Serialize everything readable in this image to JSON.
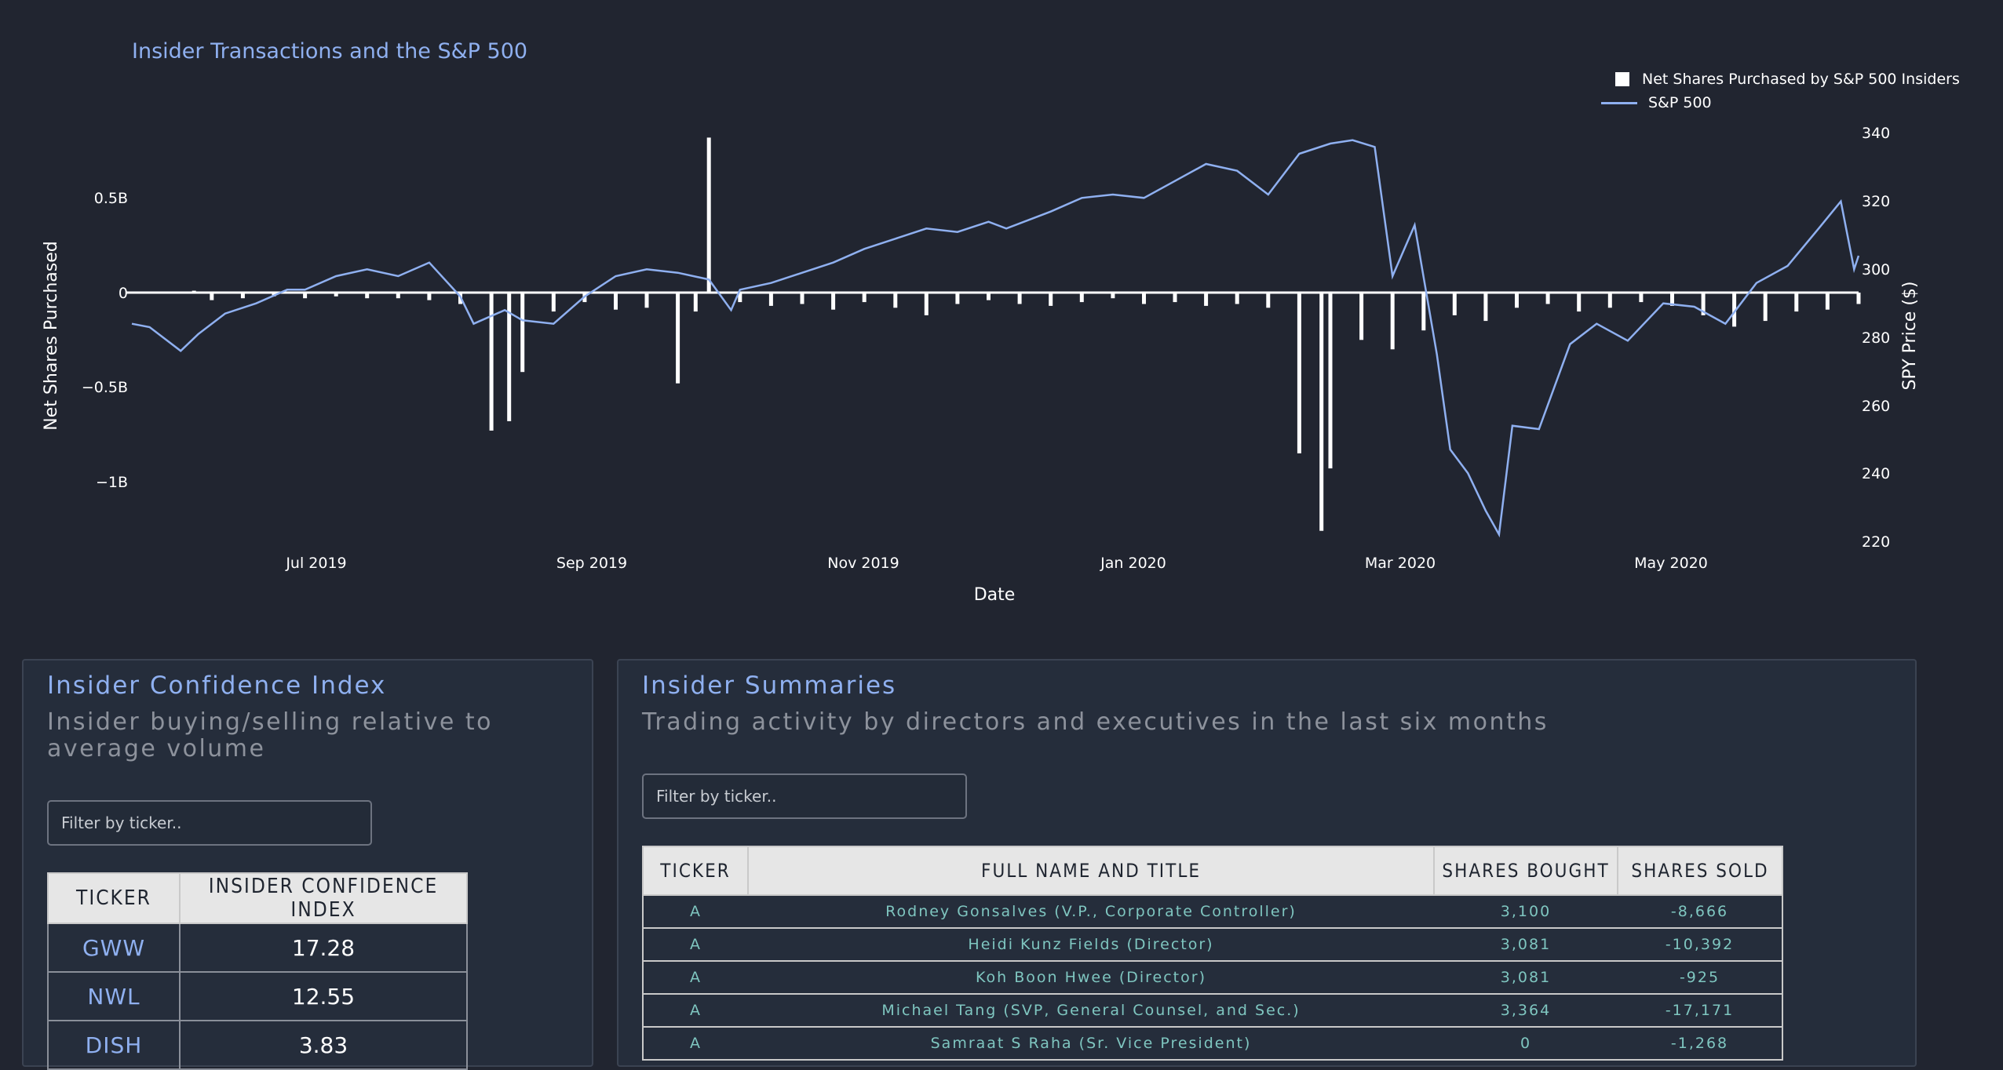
{
  "chart": {
    "title": "Insider Transactions and the S&P 500",
    "legend": [
      "Net Shares Purchased by S&P 500 Insiders",
      "S&P 500"
    ],
    "xlabel": "Date",
    "ylabel_left": "Net Shares Purchased",
    "ylabel_right": "SPY Price ($)",
    "x_ticks": [
      "Jul 2019",
      "Sep 2019",
      "Nov 2019",
      "Jan 2020",
      "Mar 2020",
      "May 2020"
    ],
    "y_left_ticks": [
      "0.5B",
      "0",
      "−0.5B",
      "−1B"
    ],
    "y_right_ticks": [
      "340",
      "320",
      "300",
      "280",
      "260",
      "240",
      "220"
    ]
  },
  "chart_data": {
    "type": "line",
    "title": "Insider Transactions and the S&P 500",
    "xlabel": "Date",
    "ylabel": "Net Shares Purchased",
    "y2label": "SPY Price ($)",
    "ylim": [
      -1.2,
      0.6
    ],
    "y2lim": [
      220,
      340
    ],
    "xlim": [
      "2019-05-20",
      "2020-06-12"
    ],
    "legend_position": "top-right",
    "series": [
      {
        "name": "S&P 500",
        "type": "line",
        "axis": "right",
        "color": "#8fb0f0",
        "x": [
          "2019-05-20",
          "2019-05-24",
          "2019-05-31",
          "2019-06-04",
          "2019-06-10",
          "2019-06-17",
          "2019-06-24",
          "2019-06-28",
          "2019-07-05",
          "2019-07-12",
          "2019-07-19",
          "2019-07-26",
          "2019-08-02",
          "2019-08-05",
          "2019-08-12",
          "2019-08-16",
          "2019-08-23",
          "2019-08-30",
          "2019-09-06",
          "2019-09-13",
          "2019-09-20",
          "2019-09-27",
          "2019-10-02",
          "2019-10-04",
          "2019-10-11",
          "2019-10-18",
          "2019-10-25",
          "2019-11-01",
          "2019-11-08",
          "2019-11-15",
          "2019-11-22",
          "2019-11-29",
          "2019-12-03",
          "2019-12-13",
          "2019-12-20",
          "2019-12-27",
          "2020-01-03",
          "2020-01-10",
          "2020-01-17",
          "2020-01-24",
          "2020-01-31",
          "2020-02-07",
          "2020-02-14",
          "2020-02-19",
          "2020-02-24",
          "2020-02-28",
          "2020-03-04",
          "2020-03-09",
          "2020-03-12",
          "2020-03-16",
          "2020-03-20",
          "2020-03-23",
          "2020-03-26",
          "2020-04-01",
          "2020-04-08",
          "2020-04-14",
          "2020-04-21",
          "2020-04-29",
          "2020-05-06",
          "2020-05-13",
          "2020-05-20",
          "2020-05-27",
          "2020-06-03",
          "2020-06-08",
          "2020-06-11",
          "2020-06-12"
        ],
        "values": [
          284,
          283,
          276,
          281,
          287,
          290,
          294,
          294,
          298,
          300,
          298,
          302,
          292,
          284,
          288,
          285,
          284,
          292,
          298,
          300,
          299,
          297,
          288,
          294,
          296,
          299,
          302,
          306,
          309,
          312,
          311,
          314,
          312,
          317,
          321,
          322,
          321,
          326,
          331,
          329,
          322,
          334,
          337,
          338,
          336,
          298,
          313,
          275,
          247,
          240,
          229,
          222,
          254,
          253,
          278,
          284,
          279,
          290,
          289,
          284,
          296,
          301,
          312,
          320,
          300,
          304
        ]
      },
      {
        "name": "Net Shares Purchased by S&P 500 Insiders",
        "type": "bar",
        "axis": "left",
        "color": "#ffffff",
        "x": [
          "2019-06-03",
          "2019-06-07",
          "2019-06-14",
          "2019-06-21",
          "2019-06-28",
          "2019-07-05",
          "2019-07-12",
          "2019-07-19",
          "2019-07-26",
          "2019-08-02",
          "2019-08-09",
          "2019-08-13",
          "2019-08-16",
          "2019-08-23",
          "2019-08-30",
          "2019-09-06",
          "2019-09-13",
          "2019-09-20",
          "2019-09-24",
          "2019-09-27",
          "2019-10-04",
          "2019-10-11",
          "2019-10-18",
          "2019-10-25",
          "2019-11-01",
          "2019-11-08",
          "2019-11-15",
          "2019-11-22",
          "2019-11-29",
          "2019-12-06",
          "2019-12-13",
          "2019-12-20",
          "2019-12-27",
          "2020-01-03",
          "2020-01-10",
          "2020-01-17",
          "2020-01-24",
          "2020-01-31",
          "2020-02-07",
          "2020-02-12",
          "2020-02-14",
          "2020-02-21",
          "2020-02-28",
          "2020-03-06",
          "2020-03-13",
          "2020-03-20",
          "2020-03-27",
          "2020-04-03",
          "2020-04-10",
          "2020-04-17",
          "2020-04-24",
          "2020-05-01",
          "2020-05-08",
          "2020-05-15",
          "2020-05-22",
          "2020-05-29",
          "2020-06-05",
          "2020-06-12"
        ],
        "values": [
          0.01,
          -0.04,
          -0.03,
          -0.02,
          -0.03,
          -0.02,
          -0.03,
          -0.03,
          -0.04,
          -0.06,
          -0.73,
          -0.68,
          -0.42,
          -0.1,
          -0.05,
          -0.09,
          -0.08,
          -0.48,
          -0.1,
          0.82,
          -0.05,
          -0.07,
          -0.06,
          -0.09,
          -0.05,
          -0.08,
          -0.12,
          -0.06,
          -0.04,
          -0.06,
          -0.07,
          -0.05,
          -0.03,
          -0.06,
          -0.05,
          -0.07,
          -0.06,
          -0.08,
          -0.85,
          -1.26,
          -0.93,
          -0.25,
          -0.3,
          -0.2,
          -0.12,
          -0.15,
          -0.08,
          -0.06,
          -0.1,
          -0.08,
          -0.05,
          -0.07,
          -0.12,
          -0.18,
          -0.15,
          -0.1,
          -0.09,
          -0.06
        ]
      }
    ]
  },
  "ci_panel": {
    "title": "Insider Confidence Index",
    "subtitle": "Insider buying/selling relative to average volume",
    "filter_placeholder": "Filter by ticker..",
    "headers": [
      "TICKER",
      "INSIDER CONFIDENCE INDEX"
    ],
    "rows": [
      {
        "ticker": "GWW",
        "index": "17.28"
      },
      {
        "ticker": "NWL",
        "index": "12.55"
      },
      {
        "ticker": "DISH",
        "index": "3.83"
      }
    ]
  },
  "sum_panel": {
    "title": "Insider Summaries",
    "subtitle": "Trading activity by directors and executives in the last six months",
    "filter_placeholder": "Filter by ticker..",
    "headers": [
      "TICKER",
      "FULL NAME AND TITLE",
      "SHARES BOUGHT",
      "SHARES SOLD"
    ],
    "rows": [
      {
        "ticker": "A",
        "name": "Rodney Gonsalves (V.P., Corporate Controller)",
        "bought": "3,100",
        "sold": "-8,666"
      },
      {
        "ticker": "A",
        "name": "Heidi Kunz Fields (Director)",
        "bought": "3,081",
        "sold": "-10,392"
      },
      {
        "ticker": "A",
        "name": "Koh Boon Hwee (Director)",
        "bought": "3,081",
        "sold": "-925"
      },
      {
        "ticker": "A",
        "name": "Michael Tang (SVP, General Counsel, and Sec.)",
        "bought": "3,364",
        "sold": "-17,171"
      },
      {
        "ticker": "A",
        "name": "Samraat S Raha (Sr. Vice President)",
        "bought": "0",
        "sold": "-1,268"
      }
    ]
  }
}
